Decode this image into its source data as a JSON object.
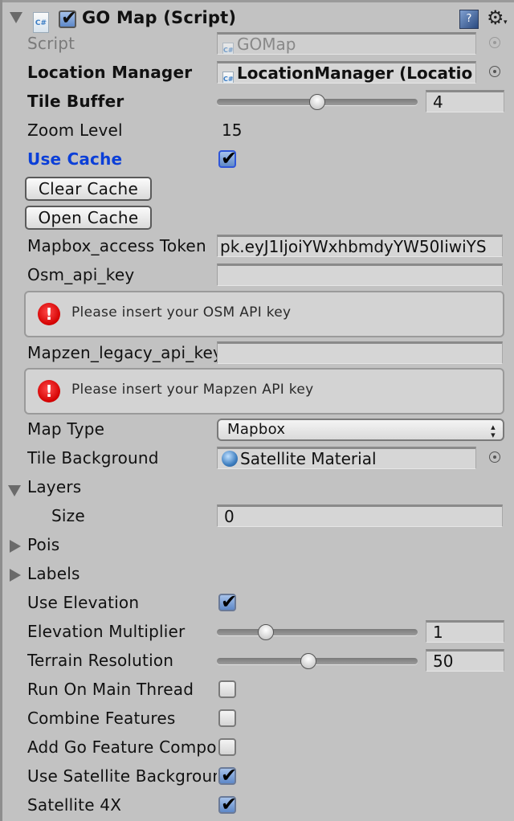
{
  "header": {
    "title": "GO Map (Script)",
    "enabled": true,
    "script_icon_glyph": "C#",
    "help_icon_glyph": "?",
    "gear_icon_glyph": "⚙",
    "gear_caret": "▾"
  },
  "fields": {
    "script": {
      "label": "Script",
      "value": "GOMap"
    },
    "location_manager": {
      "label": "Location Manager",
      "value": "LocationManager (Locatio"
    },
    "tile_buffer": {
      "label": "Tile Buffer",
      "value": "4",
      "slider_fraction": 0.5
    },
    "zoom_level": {
      "label": "Zoom Level",
      "value": "15"
    },
    "use_cache": {
      "label": "Use Cache",
      "checked": true
    },
    "clear_cache_button": "Clear Cache",
    "open_cache_button": "Open Cache",
    "mapbox_token": {
      "label": "Mapbox_access Token",
      "value": "pk.eyJ1IjoiYWxhbmdyYW50IiwiYS"
    },
    "osm_api_key": {
      "label": "Osm_api_key",
      "value": ""
    },
    "osm_warning": "Please insert your OSM API key",
    "mapzen_key": {
      "label": "Mapzen_legacy_api_key",
      "value": ""
    },
    "mapzen_warning": "Please insert your Mapzen API key",
    "map_type": {
      "label": "Map Type",
      "value": "Mapbox",
      "arrows": "▴▾"
    },
    "tile_background": {
      "label": "Tile Background",
      "value": "Satellite Material"
    },
    "layers": {
      "label": "Layers",
      "expanded": true,
      "size_label": "Size",
      "size_value": "0"
    },
    "pois": {
      "label": "Pois",
      "expanded": false
    },
    "labels": {
      "label": "Labels",
      "expanded": false
    },
    "use_elevation": {
      "label": "Use Elevation",
      "checked": true
    },
    "elevation_multiplier": {
      "label": "Elevation Multiplier",
      "value": "1",
      "slider_fraction": 0.22
    },
    "terrain_resolution": {
      "label": "Terrain Resolution",
      "value": "50",
      "slider_fraction": 0.45
    },
    "run_on_main_thread": {
      "label": "Run On Main Thread",
      "checked": false
    },
    "combine_features": {
      "label": "Combine Features",
      "checked": false
    },
    "add_go_feature": {
      "label": "Add Go Feature Components",
      "checked": false
    },
    "use_satellite_background": {
      "label": "Use Satellite Background",
      "checked": true
    },
    "satellite_4x": {
      "label": "Satellite 4X",
      "checked": true
    }
  },
  "icons": {
    "check_glyph": "✔",
    "error_glyph": "!"
  }
}
